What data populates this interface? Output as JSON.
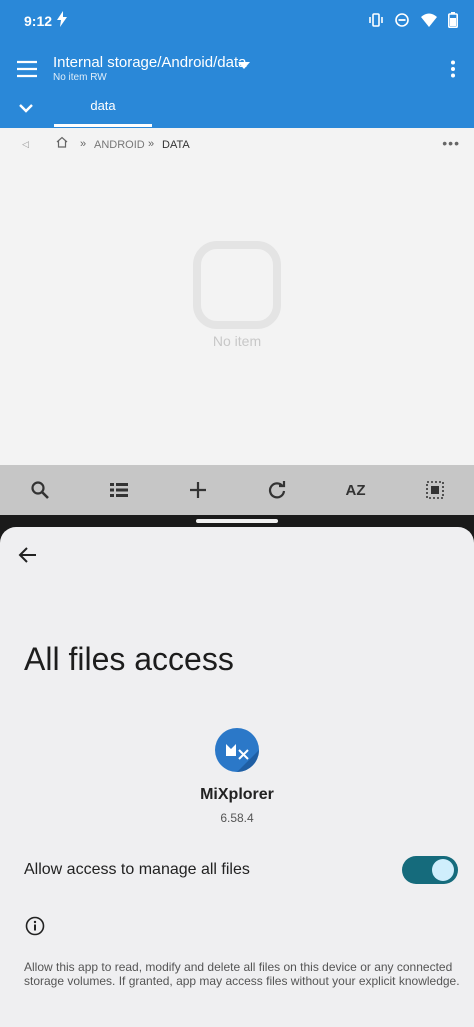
{
  "status": {
    "time": "9:12"
  },
  "appbar": {
    "title": "Internal storage/Android/data",
    "subtitle": "No item RW",
    "tab": "data"
  },
  "breadcrumb": {
    "sep": "»",
    "android": "ANDROID",
    "data": "DATA",
    "more": "•••"
  },
  "empty": {
    "text": "No item"
  },
  "toolbar": {
    "sort_label": "AZ"
  },
  "settings": {
    "title": "All files access",
    "app_name": "MiXplorer",
    "version": "6.58.4",
    "permission_label": "Allow access to manage all files",
    "permission_enabled": true,
    "info_text": "Allow this app to read, modify and delete all files on this device or any connected storage volumes. If granted, app may access files without your explicit knowledge."
  },
  "colors": {
    "accent": "#2a88d8",
    "toggle_track": "#156b7c",
    "toggle_knob": "#cfeefc"
  },
  "icons": [
    "menu-icon",
    "more-vert-icon",
    "chevron-down-icon",
    "home-icon",
    "search-icon",
    "list-icon",
    "add-icon",
    "refresh-icon",
    "select-all-icon",
    "back-arrow-icon",
    "info-icon"
  ]
}
